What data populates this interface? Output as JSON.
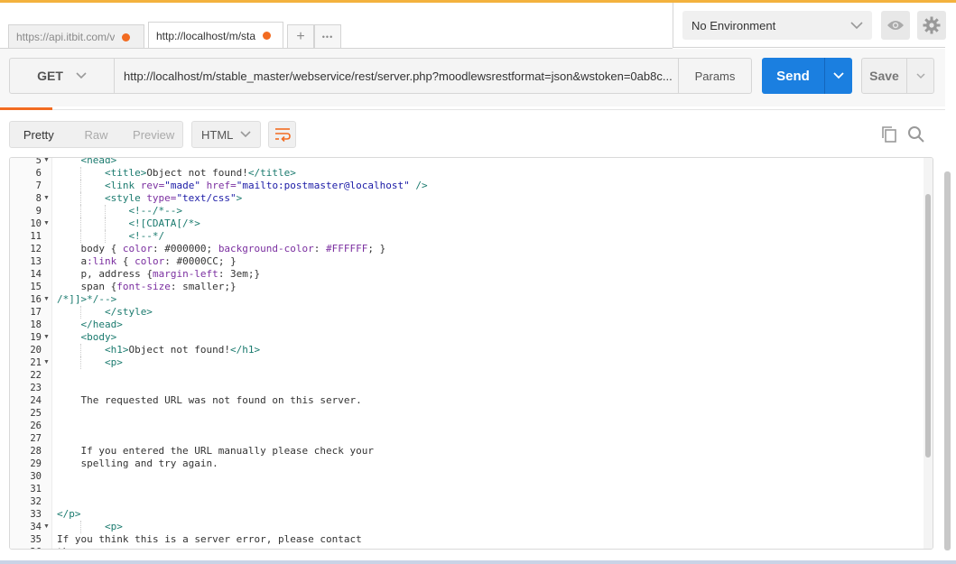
{
  "tabs": [
    {
      "label": "https://api.itbit.com/v",
      "active": false
    },
    {
      "label": "http://localhost/m/sta",
      "active": true
    }
  ],
  "tab_controls": {
    "add": "+",
    "more": "•••"
  },
  "environment": {
    "selected": "No Environment"
  },
  "request": {
    "method": "GET",
    "url": "http://localhost/m/stable_master/webservice/rest/server.php?moodlewsrestformat=json&wstoken=0ab8c...",
    "params_label": "Params",
    "send_label": "Send",
    "save_label": "Save"
  },
  "response": {
    "views": [
      "Pretty",
      "Raw",
      "Preview"
    ],
    "active_view": "Pretty",
    "format": "HTML"
  },
  "colors": {
    "tag": "#1a7a6e",
    "attr": "#7b2fa0",
    "string": "#1a1aa6",
    "text": "#333333",
    "accent": "#f26b21",
    "send": "#1b7fe0"
  },
  "code_lines": [
    {
      "n": "5",
      "fold": true,
      "indent": 1,
      "tokens": [
        [
          "<head>",
          "tag"
        ]
      ]
    },
    {
      "n": "6",
      "indent": 2,
      "tokens": [
        [
          "<title>",
          "tag"
        ],
        [
          "Object not found!",
          "text"
        ],
        [
          "</title>",
          "tag"
        ]
      ]
    },
    {
      "n": "7",
      "indent": 2,
      "tokens": [
        [
          "<link ",
          "tag"
        ],
        [
          "rev=",
          "attr"
        ],
        [
          "\"made\"",
          "string"
        ],
        [
          " ",
          "text"
        ],
        [
          "href=",
          "attr"
        ],
        [
          "\"mailto:postmaster@localhost\"",
          "string"
        ],
        [
          " />",
          "tag"
        ]
      ]
    },
    {
      "n": "8",
      "fold": true,
      "indent": 2,
      "tokens": [
        [
          "<style ",
          "tag"
        ],
        [
          "type=",
          "attr"
        ],
        [
          "\"text/css\"",
          "string"
        ],
        [
          ">",
          "tag"
        ]
      ]
    },
    {
      "n": "9",
      "indent": 3,
      "tokens": [
        [
          "<!--/*-->",
          "tag"
        ]
      ]
    },
    {
      "n": "10",
      "fold": true,
      "indent": 3,
      "tokens": [
        [
          "<![CDATA[/*>",
          "tag"
        ]
      ]
    },
    {
      "n": "11",
      "indent": 3,
      "tokens": [
        [
          "<!--*/",
          "tag"
        ]
      ]
    },
    {
      "n": "12",
      "indent": 1,
      "tokens": [
        [
          "body { ",
          "text"
        ],
        [
          "color",
          "attr"
        ],
        [
          ": #000000; ",
          "text"
        ],
        [
          "background-color",
          "attr"
        ],
        [
          ": ",
          "text"
        ],
        [
          "#FFFFFF",
          "attr"
        ],
        [
          "; }",
          "text"
        ]
      ]
    },
    {
      "n": "13",
      "indent": 1,
      "tokens": [
        [
          "a",
          "text"
        ],
        [
          ":link",
          "attr"
        ],
        [
          " { ",
          "text"
        ],
        [
          "color",
          "attr"
        ],
        [
          ": #0000CC; }",
          "text"
        ]
      ]
    },
    {
      "n": "14",
      "indent": 1,
      "tokens": [
        [
          "p, address {",
          "text"
        ],
        [
          "margin-left",
          "attr"
        ],
        [
          ": 3em;}",
          "text"
        ]
      ]
    },
    {
      "n": "15",
      "indent": 1,
      "tokens": [
        [
          "span {",
          "text"
        ],
        [
          "font-size",
          "attr"
        ],
        [
          ": smaller;}",
          "text"
        ]
      ]
    },
    {
      "n": "16",
      "fold": true,
      "indent": 0,
      "tokens": [
        [
          "/*]]>*/-->",
          "tag"
        ]
      ]
    },
    {
      "n": "17",
      "indent": 2,
      "tokens": [
        [
          "</style>",
          "tag"
        ]
      ]
    },
    {
      "n": "18",
      "indent": 1,
      "tokens": [
        [
          "</head>",
          "tag"
        ]
      ]
    },
    {
      "n": "19",
      "fold": true,
      "indent": 1,
      "tokens": [
        [
          "<body>",
          "tag"
        ]
      ]
    },
    {
      "n": "20",
      "indent": 2,
      "tokens": [
        [
          "<h1>",
          "tag"
        ],
        [
          "Object not found!",
          "text"
        ],
        [
          "</h1>",
          "tag"
        ]
      ]
    },
    {
      "n": "21",
      "fold": true,
      "indent": 2,
      "tokens": [
        [
          "<p>",
          "tag"
        ]
      ]
    },
    {
      "n": "22",
      "indent": 0,
      "tokens": []
    },
    {
      "n": "23",
      "indent": 0,
      "tokens": []
    },
    {
      "n": "24",
      "indent": 1,
      "tokens": [
        [
          "The requested URL was not found on this server.",
          "text"
        ]
      ]
    },
    {
      "n": "25",
      "indent": 0,
      "tokens": []
    },
    {
      "n": "26",
      "indent": 0,
      "tokens": []
    },
    {
      "n": "27",
      "indent": 0,
      "tokens": []
    },
    {
      "n": "28",
      "indent": 1,
      "tokens": [
        [
          "If you entered the URL manually please check your",
          "text"
        ]
      ]
    },
    {
      "n": "29",
      "indent": 1,
      "tokens": [
        [
          "spelling and try again.",
          "text"
        ]
      ]
    },
    {
      "n": "30",
      "indent": 0,
      "tokens": []
    },
    {
      "n": "31",
      "indent": 0,
      "tokens": []
    },
    {
      "n": "32",
      "indent": 0,
      "tokens": []
    },
    {
      "n": "33",
      "indent": 0,
      "tokens": [
        [
          "</p>",
          "tag"
        ]
      ]
    },
    {
      "n": "34",
      "fold": true,
      "indent": 2,
      "tokens": [
        [
          "<p>",
          "tag"
        ]
      ]
    },
    {
      "n": "35",
      "indent": 0,
      "tokens": [
        [
          "If you think this is a server error, please contact",
          "text"
        ]
      ]
    },
    {
      "n": "36",
      "fold": true,
      "indent": 0,
      "tokens": [
        [
          "the",
          "text"
        ]
      ]
    }
  ]
}
